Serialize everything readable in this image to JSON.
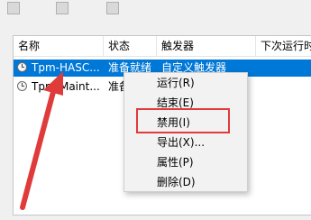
{
  "columns": [
    "名称",
    "状态",
    "触发器",
    "下次运行时"
  ],
  "tasks": [
    {
      "name": "Tpm-HASC...",
      "status": "准备就绪",
      "trigger": "自定义触发器",
      "selected": true
    },
    {
      "name": "Tpm-Maint...",
      "status": "准备",
      "trigger": "",
      "selected": false
    }
  ],
  "context_menu": [
    "运行(R)",
    "结束(E)",
    "禁用(I)",
    "导出(X)...",
    "属性(P)",
    "删除(D)"
  ],
  "colors": {
    "selection": "#0078d7",
    "annotation": "#e03b3b"
  }
}
